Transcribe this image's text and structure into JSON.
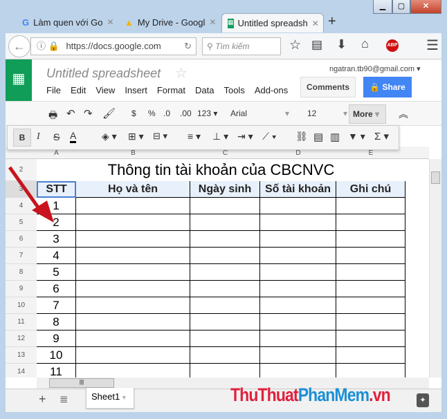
{
  "browser": {
    "tabs": [
      {
        "label": "Làm quen với Go",
        "icon": "google-icon"
      },
      {
        "label": "My Drive - Googl",
        "icon": "drive-icon"
      },
      {
        "label": "Untitled spreadsh",
        "icon": "sheets-icon",
        "active": true
      }
    ],
    "new_tab": "+",
    "url": "https://docs.google.com",
    "search_placeholder": "Tìm kiếm",
    "abp": "ABP"
  },
  "doc": {
    "title": "Untitled spreadsheet",
    "account": "ngatran.tb90@gmail.com",
    "comments": "Comments",
    "share": "Share",
    "menu": [
      "File",
      "Edit",
      "View",
      "Insert",
      "Format",
      "Data",
      "Tools",
      "Add-ons"
    ]
  },
  "toolbar": {
    "currency": "$",
    "percent": "%",
    "dec_dec": ".0",
    "inc_dec": ".00",
    "format": "123",
    "font": "Arial",
    "size": "12",
    "more": "More"
  },
  "sheet": {
    "columns": [
      "A",
      "B",
      "C",
      "D",
      "E"
    ],
    "title_row": {
      "row": "2",
      "text": "Thông tin tài khoản của CBCNVC"
    },
    "header_row": {
      "row": "3",
      "cells": [
        "STT",
        "Họ và tên",
        "Ngày sinh",
        "Số tài khoản",
        "Ghi chú"
      ]
    },
    "rows": [
      {
        "row": "4",
        "stt": "1"
      },
      {
        "row": "5",
        "stt": "2"
      },
      {
        "row": "6",
        "stt": "3"
      },
      {
        "row": "7",
        "stt": "4"
      },
      {
        "row": "8",
        "stt": "5"
      },
      {
        "row": "9",
        "stt": "6"
      },
      {
        "row": "10",
        "stt": "7"
      },
      {
        "row": "11",
        "stt": "8"
      },
      {
        "row": "12",
        "stt": "9"
      },
      {
        "row": "13",
        "stt": "10"
      },
      {
        "row": "14",
        "stt": "11"
      }
    ],
    "tab": "Sheet1"
  },
  "watermark": {
    "part1": "ThuThuat",
    "part2": "PhanMem",
    "part3": ".vn"
  },
  "colors": {
    "sheets_green": "#0f9d58",
    "share_blue": "#4285f4",
    "header_fill": "#e8f0fb",
    "arrow": "#c8141e",
    "wm_red": "#e0203c",
    "wm_blue": "#1a8fd6"
  }
}
